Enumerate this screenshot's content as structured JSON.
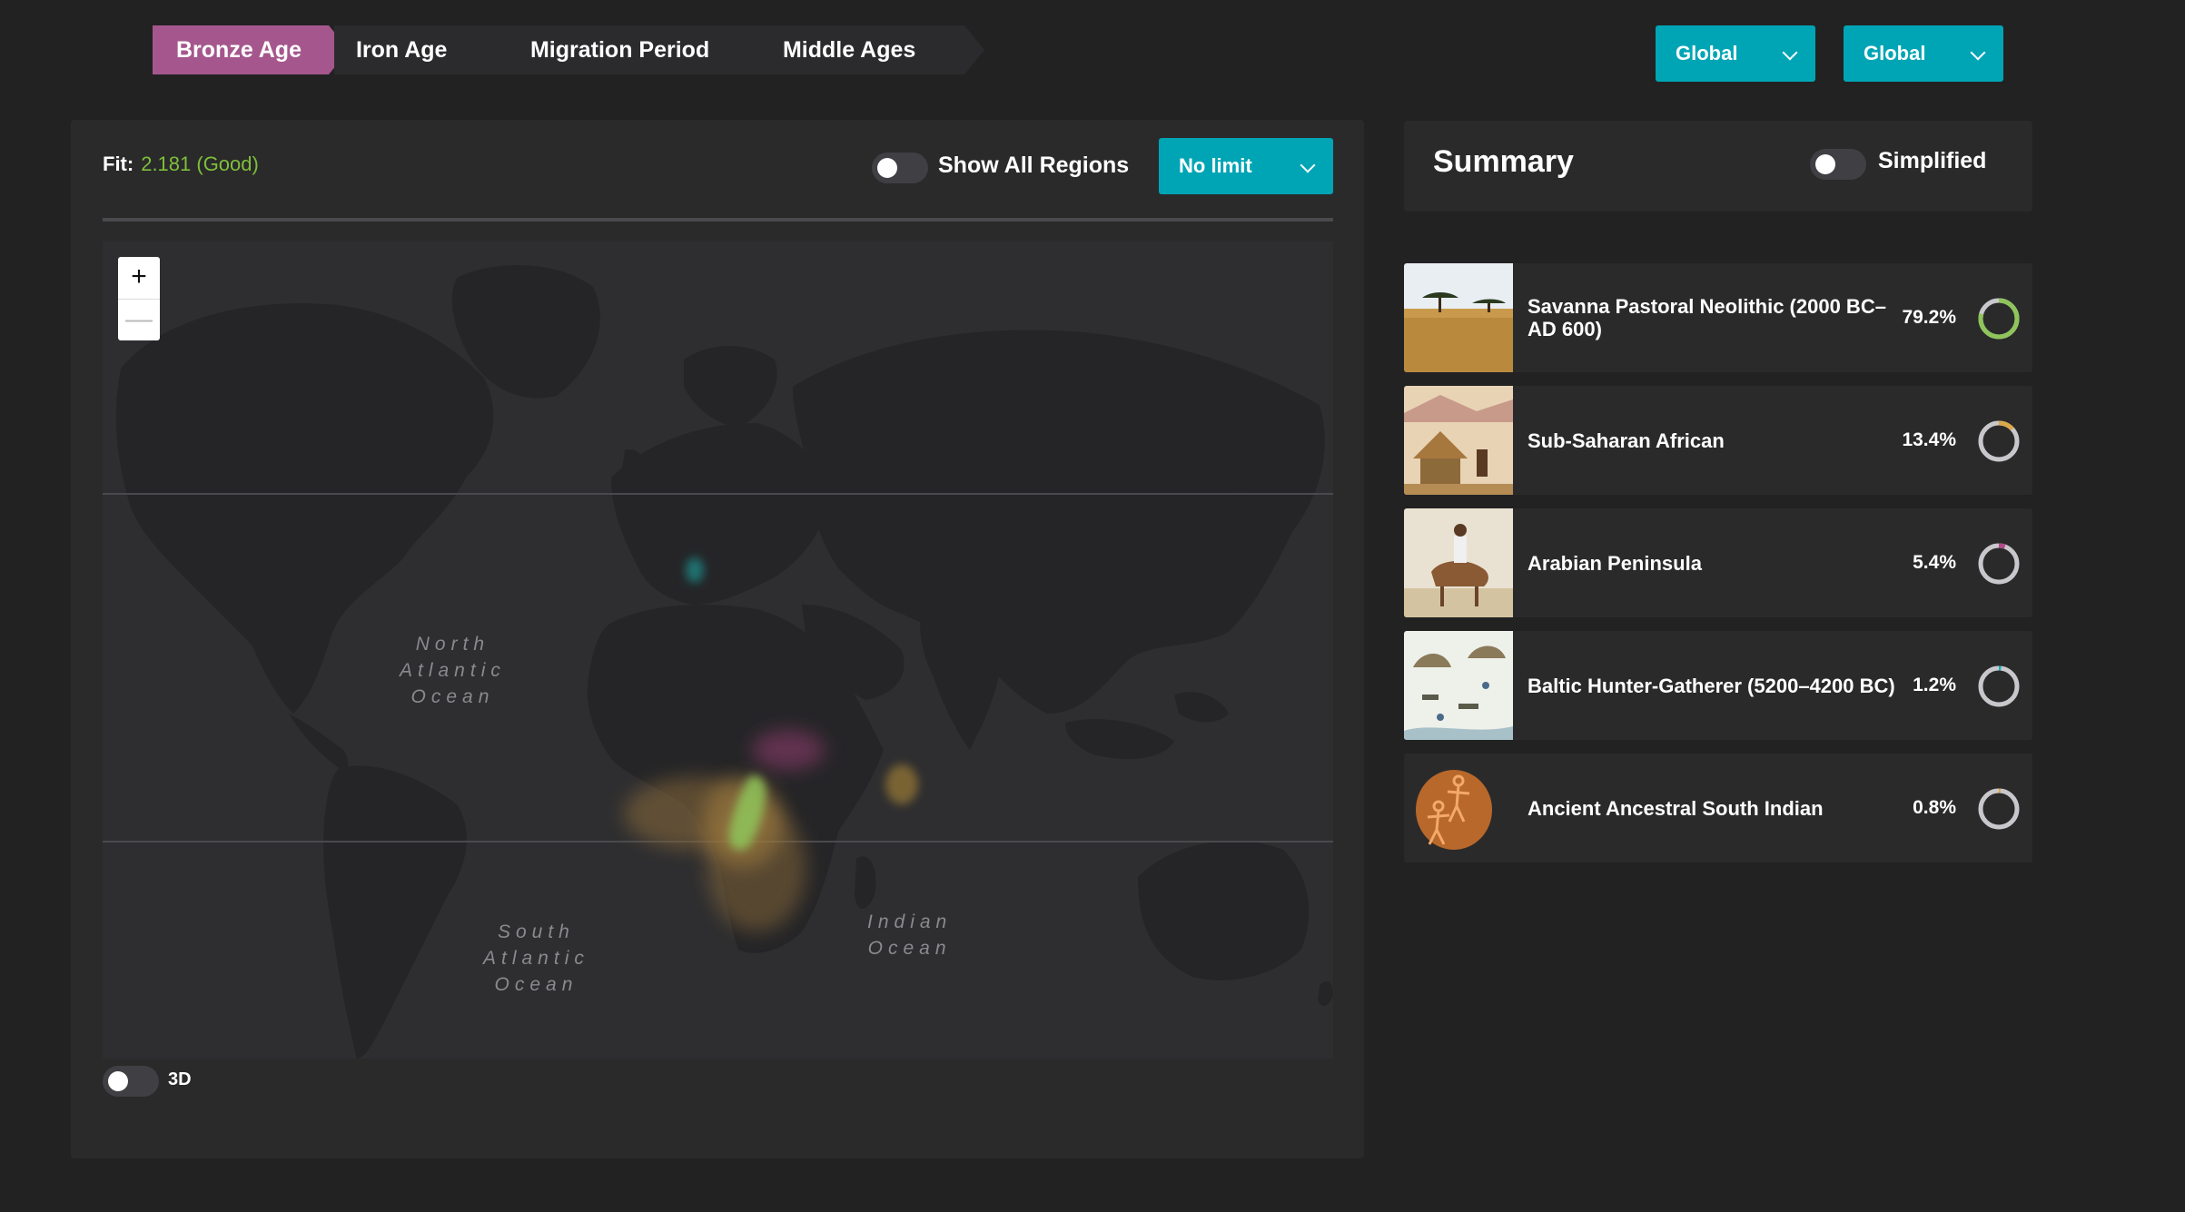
{
  "eras": [
    {
      "label": "Bronze Age",
      "active": true
    },
    {
      "label": "Iron Age",
      "active": false
    },
    {
      "label": "Migration Period",
      "active": false
    },
    {
      "label": "Middle Ages",
      "active": false
    }
  ],
  "selectors": [
    {
      "value": "Global"
    },
    {
      "value": "Global"
    }
  ],
  "fit": {
    "label": "Fit:",
    "value": "2.181 (Good)"
  },
  "show_all_regions": {
    "label": "Show All Regions",
    "on": false
  },
  "limit_select": {
    "value": "No limit"
  },
  "map": {
    "zoom_in": "+",
    "zoom_out": "—",
    "oceans": {
      "north_atlantic": [
        "North",
        "Atlantic",
        "Ocean"
      ],
      "south_atlantic": [
        "South",
        "Atlantic",
        "Ocean"
      ],
      "indian": [
        "Indian",
        "Ocean"
      ]
    },
    "toggle_3d": {
      "label": "3D",
      "on": false
    }
  },
  "summary": {
    "title": "Summary",
    "simplified": {
      "label": "Simplified",
      "on": false
    },
    "items": [
      {
        "name": "Savanna Pastoral Neolithic (2000 BC–AD 600)",
        "percent": "79.2%",
        "color": "#8fc45a"
      },
      {
        "name": "Sub-Saharan African",
        "percent": "13.4%",
        "color": "#d9a94a"
      },
      {
        "name": "Arabian Peninsula",
        "percent": "5.4%",
        "color": "#b4488c"
      },
      {
        "name": "Baltic Hunter-Gatherer (5200–4200 BC)",
        "percent": "1.2%",
        "color": "#1ab0b8"
      },
      {
        "name": "Ancient Ancestral South Indian",
        "percent": "0.8%",
        "color": "#e0a330"
      }
    ]
  },
  "colors": {
    "accent": "#00a5b5",
    "active_era": "#a5578d",
    "fit_good": "#7fbf3a",
    "background": "#222223",
    "panel": "#2a2a2b"
  }
}
